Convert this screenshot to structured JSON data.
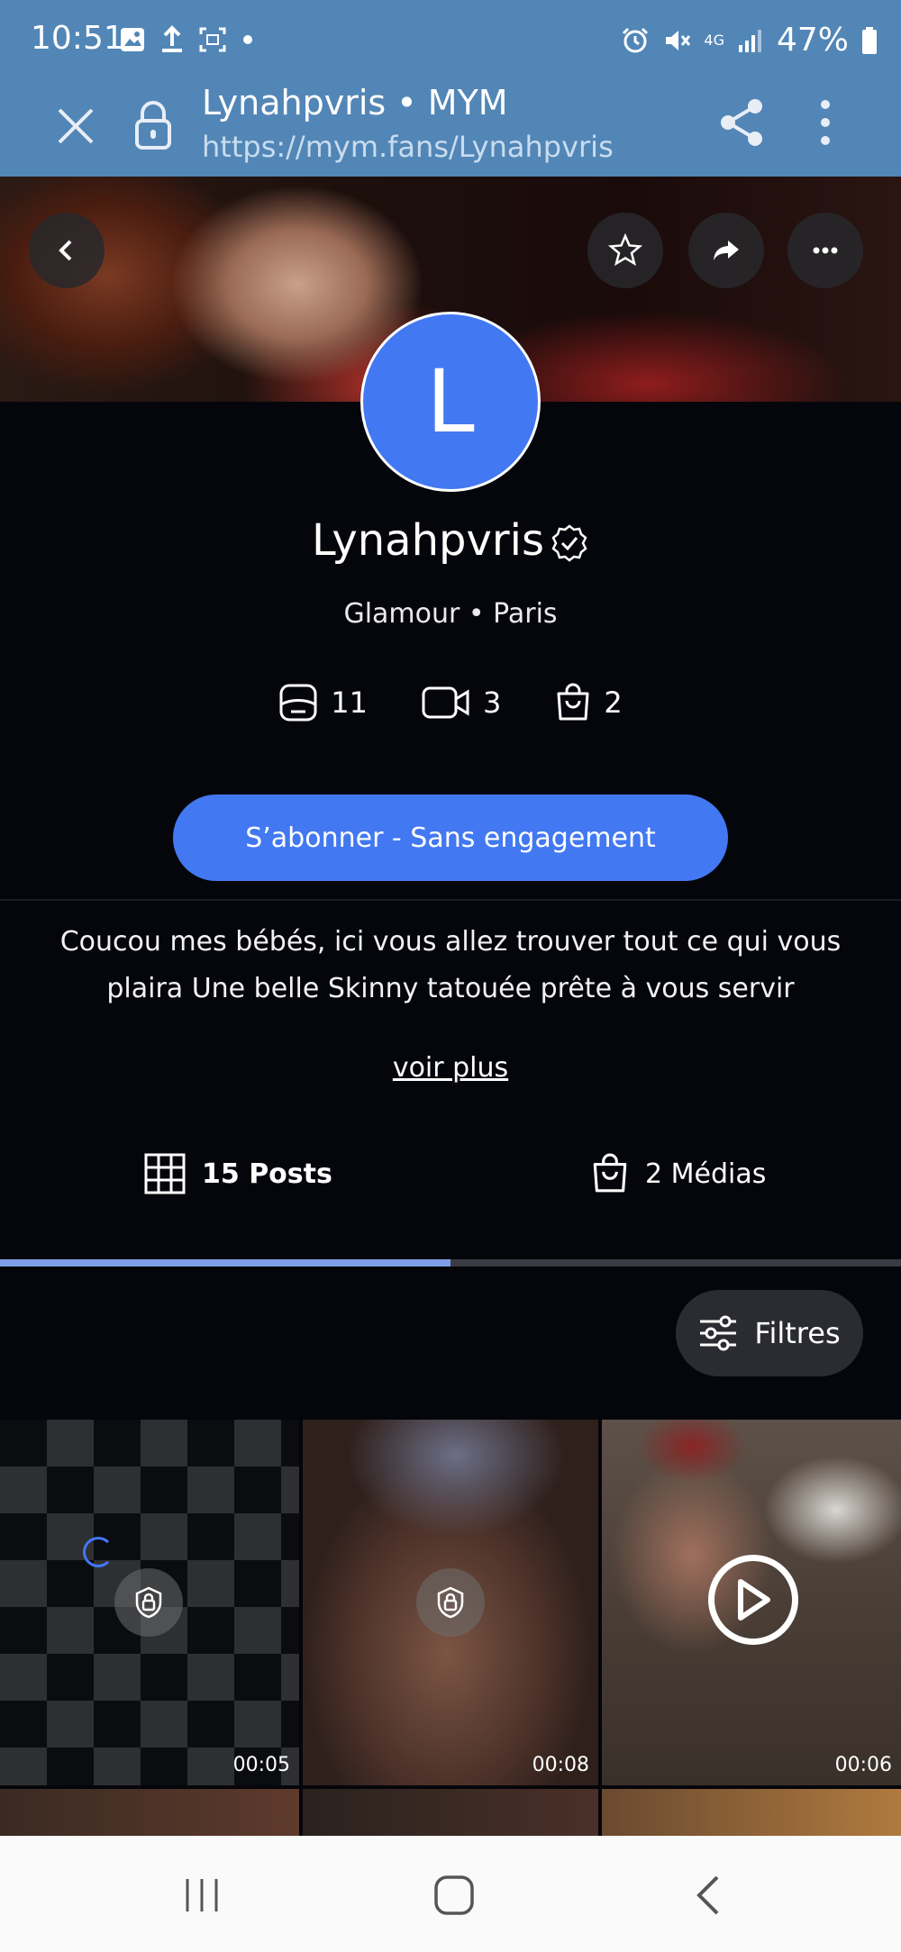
{
  "status_bar": {
    "time": "10:51",
    "battery": "47%",
    "network": "4G",
    "icons": [
      "image-icon",
      "upload-icon",
      "screenshot-icon",
      "dot-icon",
      "alarm-icon",
      "mute-icon",
      "signal-icon",
      "battery-icon"
    ]
  },
  "browser": {
    "title": "Lynahpvris • MYM",
    "url": "https://mym.fans/Lynahpvris",
    "icons": [
      "close-icon",
      "lock-icon",
      "share-icon",
      "more-vertical-icon"
    ]
  },
  "cover": {
    "buttons": [
      "back-icon",
      "star-icon",
      "share-arrow-icon",
      "more-horizontal-icon"
    ]
  },
  "profile": {
    "avatar_letter": "L",
    "name": "Lynahpvris",
    "verified": true,
    "subtitle": "Glamour • Paris",
    "stats": [
      {
        "icon": "photo-icon",
        "value": "11"
      },
      {
        "icon": "video-icon",
        "value": "3"
      },
      {
        "icon": "bag-icon",
        "value": "2"
      }
    ],
    "subscribe_label": "S’abonner - Sans engagement",
    "bio": "Coucou mes bébés, ici vous allez trouver tout ce qui vous plaira Une belle Skinny tatouée prête à vous servir",
    "more_label": "voir plus"
  },
  "tabs": [
    {
      "label": "15 Posts",
      "icon": "grid-icon",
      "active": true
    },
    {
      "label": "2 Médias",
      "icon": "bag-icon",
      "active": false
    }
  ],
  "filters_label": "Filtres",
  "posts": [
    {
      "duration": "00:05",
      "locked": true,
      "loading": true
    },
    {
      "duration": "00:08",
      "locked": true,
      "loading": false
    },
    {
      "duration": "00:06",
      "locked": false,
      "playable": true
    }
  ],
  "colors": {
    "accent": "#4278f2",
    "header": "#5286b6",
    "background": "#05060b"
  }
}
